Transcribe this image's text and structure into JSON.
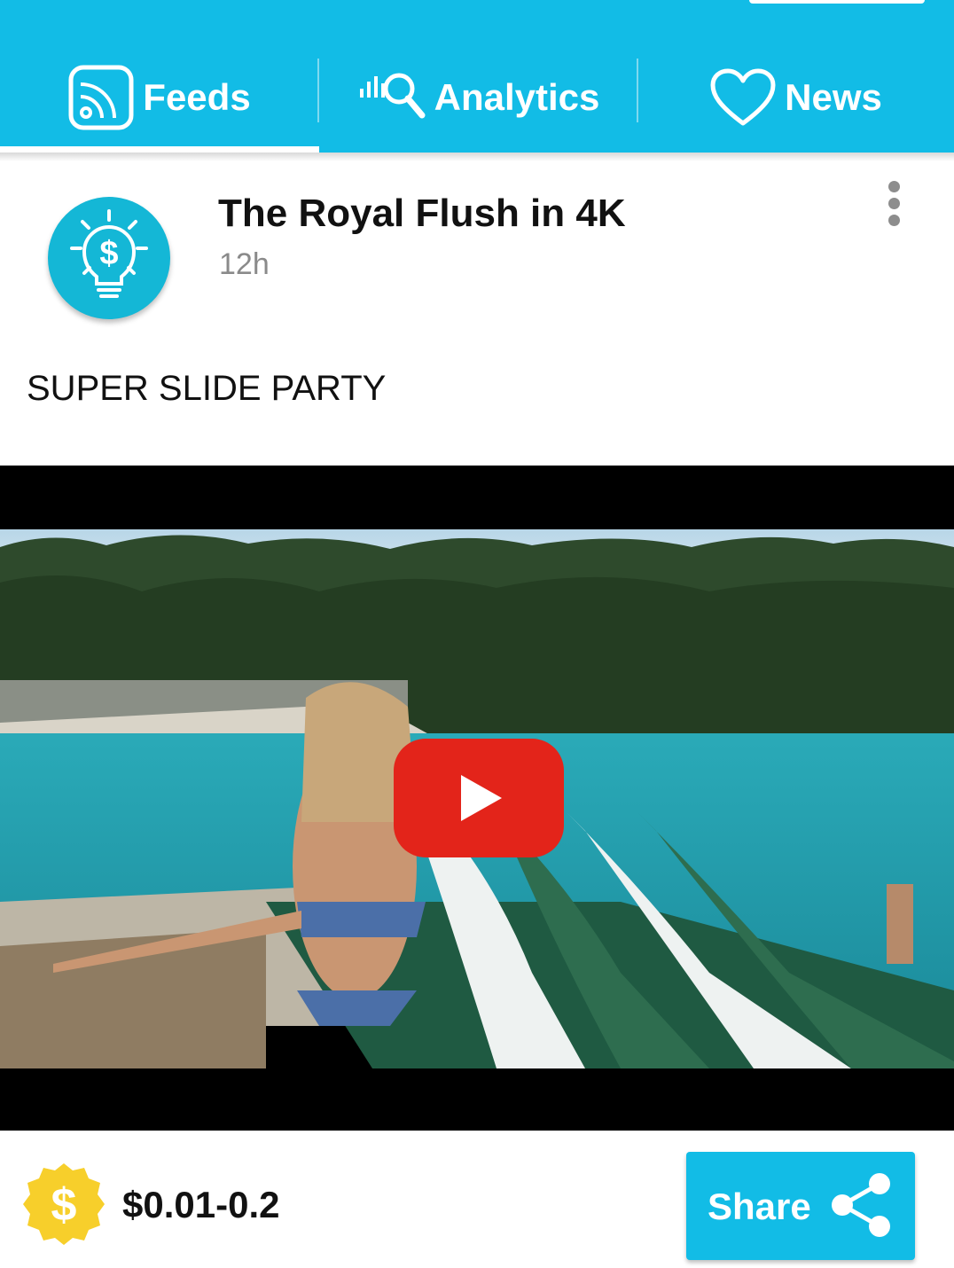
{
  "tabs": [
    {
      "label": "Feeds",
      "icon": "rss-feed-icon",
      "active": true
    },
    {
      "label": "Analytics",
      "icon": "analytics-search-icon",
      "active": false
    },
    {
      "label": "News",
      "icon": "heart-icon",
      "active": false
    }
  ],
  "post": {
    "avatar_icon": "dollar-lightbulb-icon",
    "title": "The Royal Flush in 4K",
    "time": "12h",
    "text": "SUPER SLIDE PARTY",
    "video": {
      "play_icon": "youtube-play-icon"
    }
  },
  "footer": {
    "coin_icon": "dollar-coin-icon",
    "price": "$0.01-0.2",
    "share_label": "Share",
    "share_icon": "share-icon"
  },
  "colors": {
    "accent": "#12bce6",
    "play_red": "#e3241a",
    "coin_yellow": "#f7cf2b"
  }
}
